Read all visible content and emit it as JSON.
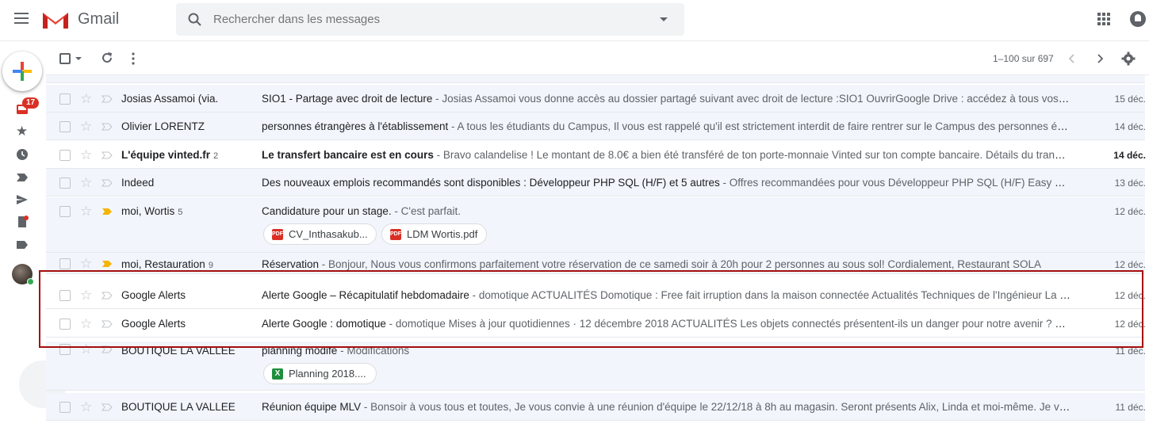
{
  "header": {
    "brand": "Gmail",
    "search_placeholder": "Rechercher dans les messages"
  },
  "rail": {
    "inbox_badge": "17"
  },
  "toolbar": {
    "pager": "1–100 sur 697"
  },
  "emails": [
    {
      "sender": "Josias Assamoi (via.",
      "count": "",
      "subject": "SIO1 - Partage avec droit de lecture",
      "snippet": " - Josias Assamoi vous donne accès au dossier partagé suivant avec droit de lecture :SIO1 OuvrirGoogle Drive : accédez à tous vos fichiers de...",
      "date": "15 déc."
    },
    {
      "sender": "Olivier LORENTZ",
      "count": "",
      "subject": "personnes étrangères à l'établissement",
      "snippet": " - A tous les étudiants du Campus, Il vous est rappelé qu'il est strictement interdit de faire rentrer sur le Campus des personnes étrangères ...",
      "date": "14 déc."
    },
    {
      "sender": "L'équipe vinted.fr",
      "count": "2",
      "subject": "Le transfert bancaire est en cours",
      "snippet": " -  Bravo calandelise ! Le montant de 8.0€ a bien été transféré de ton porte-monnaie Vinted sur ton compte bancaire. Détails du transfert : Bénéfi...",
      "date": "14 déc."
    },
    {
      "sender": "Indeed",
      "count": "",
      "subject": "Des nouveaux emplois recommandés sont disponibles : Développeur PHP SQL (H/F) et 5 autres",
      "snippet": " - Offres recommandées pour vous Développeur PHP SQL (H/F) Easy Partner - Pari...",
      "date": "13 déc."
    },
    {
      "sender": "moi, Wortis",
      "count": "5",
      "subject": "Candidature pour un stage.",
      "snippet": " - C'est parfait.",
      "date": "12 déc."
    },
    {
      "sender": "moi, Restauration",
      "count": "9",
      "subject": "Réservation",
      "snippet": " - Bonjour, Nous vous confirmons parfaitement votre réservation de ce samedi soir à 20h pour 2 personnes au sous sol! Cordialement, Restaurant SOLA",
      "date": "12 déc."
    },
    {
      "sender": "Google Alerts",
      "count": "",
      "subject": "Alerte Google – Récapitulatif hebdomadaire",
      "snippet": " - domotique ACTUALITÉS Domotique : Free fait irruption dans la maison connectée Actualités Techniques de l'Ingénieur La nouvelle F...",
      "date": "12 déc."
    },
    {
      "sender": "Google Alerts",
      "count": "",
      "subject": "Alerte Google : domotique",
      "snippet": " - domotique Mises à jour quotidiennes · 12 décembre 2018 ACTUALITÉS Les objets connectés présentent-ils un danger pour notre avenir ? Selectra Alo...",
      "date": "12 déc."
    },
    {
      "sender": "BOUTIQUE LA VALLEE",
      "count": "",
      "subject": "planning modifé",
      "snippet": " - Modifications",
      "date": "11 déc."
    },
    {
      "sender": "BOUTIQUE LA VALLEE",
      "count": "",
      "subject": "Réunion équipe MLV",
      "snippet": " - Bonsoir à vous tous et toutes, Je vous convie à une réunion d'équipe le 22/12/18 à 8h au magasin. Seront présents Alix, Linda et moi-même. Je vous rappell...",
      "date": "11 déc."
    }
  ],
  "attachments": {
    "a1": {
      "name": "CV_Inthasakub...",
      "type": "PDF"
    },
    "a2": {
      "name": "LDM Wortis.pdf",
      "type": "PDF"
    },
    "a3": {
      "name": "Planning 2018....",
      "type": "X"
    }
  },
  "colors": {
    "highlight_border": "#a50d0d",
    "pdf_icon": "#d93025",
    "xls_icon": "#1e8e3e",
    "important_marker": "#f4b400"
  }
}
